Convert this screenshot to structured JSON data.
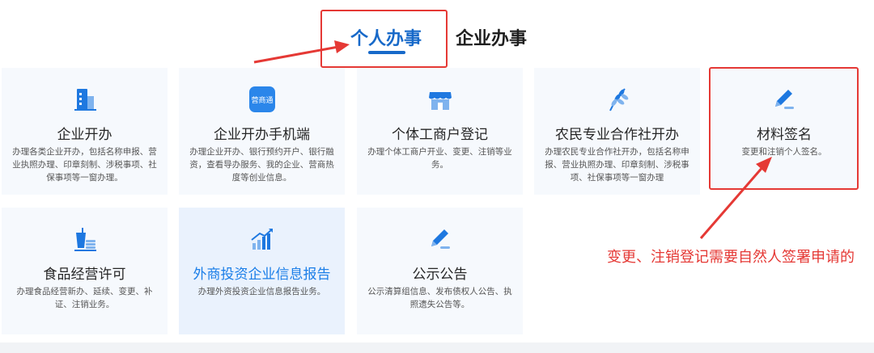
{
  "tabs": [
    {
      "label": "个人办事",
      "active": true
    },
    {
      "label": "企业办事",
      "active": false
    }
  ],
  "cards": [
    {
      "title": "企业开办",
      "desc": "办理各类企业开办，包括名称申报、营业执照办理、印章刻制、涉税事项、社保事项等一窗办理。",
      "icon": "building-icon"
    },
    {
      "title": "企业开办手机端",
      "desc": "办理企业开办、银行预约开户、银行融资，查看导办服务、我的企业、营商热度等创业信息。",
      "icon": "mobile-app-icon",
      "icon_text": "营商通"
    },
    {
      "title": "个体工商户登记",
      "desc": "办理个体工商户开业、变更、注销等业务。",
      "icon": "shop-icon"
    },
    {
      "title": "农民专业合作社开办",
      "desc": "办理农民专业合作社开办，包括名称申报、营业执照办理、印章刻制、涉税事项、社保事项等一窗办理",
      "icon": "wheat-icon"
    },
    {
      "title": "材料签名",
      "desc": "变更和注销个人签名。",
      "icon": "pen-sign-icon"
    },
    {
      "title": "食品经营许可",
      "desc": "办理食品经营新办、延续、变更、补证、注销业务。",
      "icon": "food-drink-icon"
    },
    {
      "title": "外商投资企业信息报告",
      "desc": "办理外资投资企业信息报告业务。",
      "icon": "growth-chart-icon"
    },
    {
      "title": "公示公告",
      "desc": "公示清算组信息、发布债权人公告、执照遗失公告等。",
      "icon": "announce-pen-icon"
    }
  ],
  "annotation": {
    "note": "变更、注销登记需要自然人签署申请的"
  },
  "colors": {
    "accent": "#1769c9",
    "highlight": "#e53935",
    "card_bg": "#f6f9fd"
  }
}
